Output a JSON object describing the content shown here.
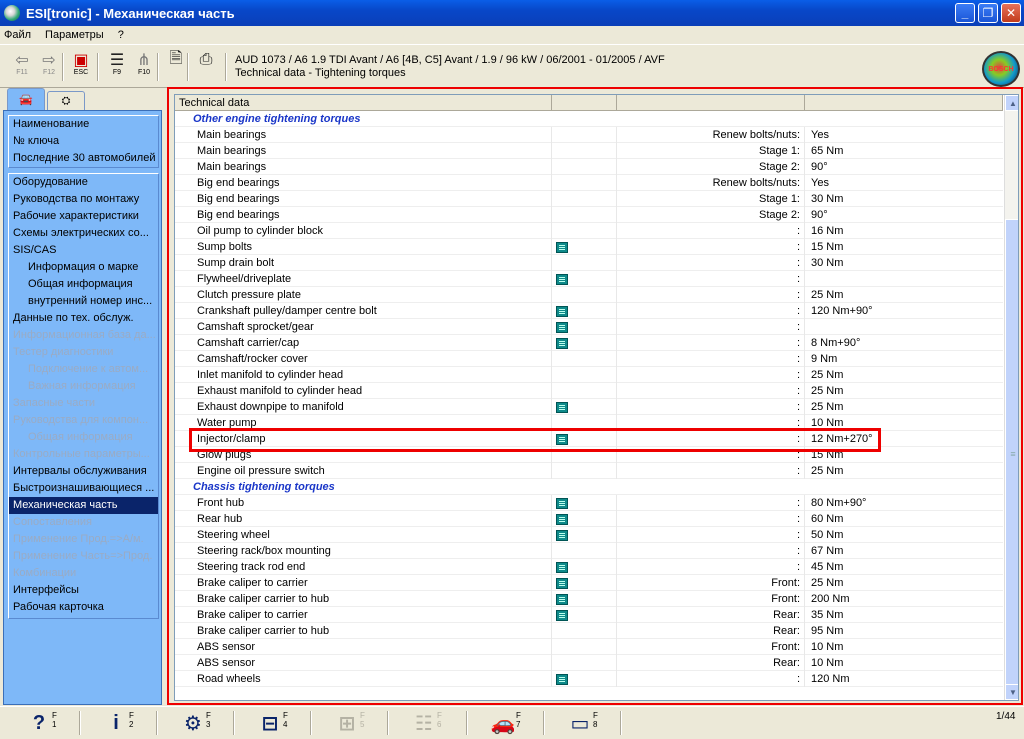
{
  "title": "ESI[tronic] - Механическая часть",
  "window_buttons": {
    "minimize": "_",
    "maximize": "❐",
    "close": "✕"
  },
  "menu": [
    "Файл",
    "Параметры",
    "?"
  ],
  "toolbar": {
    "buttons": [
      {
        "key": "F11",
        "icon": "back-arrow-icon",
        "glyph": "⇦"
      },
      {
        "key": "F12",
        "icon": "forward-arrow-icon",
        "glyph": "⇨"
      },
      {
        "key": "ESC",
        "icon": "exit-icon",
        "glyph": "▣"
      },
      {
        "key": "F9",
        "icon": "list-icon",
        "glyph": "☰"
      },
      {
        "key": "F10",
        "icon": "tree-icon",
        "glyph": "⋔"
      },
      {
        "key": "",
        "icon": "document-icon",
        "glyph": "🗎"
      },
      {
        "key": "",
        "icon": "printer-icon",
        "glyph": "⎙"
      }
    ],
    "vehicle": "AUD 1073 / A6 1.9 TDI Avant / A6 [4B, C5] Avant / 1.9 / 96 kW / 06/2001 - 01/2005 / AVF",
    "path": "Technical data - Tightening torques",
    "logo": "BOSCH"
  },
  "sidebar": {
    "tabs": [
      {
        "icon": "car-icon",
        "glyph": "🚘"
      },
      {
        "icon": "engine-icon",
        "glyph": "⛭"
      }
    ],
    "group1": [
      "Наименование",
      "№ ключа",
      "Последние 30 автомобилей"
    ],
    "group2": [
      {
        "label": "Оборудование",
        "indent": false,
        "state": "on"
      },
      {
        "label": "Руководства по монтажу",
        "indent": false,
        "state": "on"
      },
      {
        "label": "Рабочие характеристики",
        "indent": false,
        "state": "on"
      },
      {
        "label": "Схемы электрических со...",
        "indent": false,
        "state": "on"
      },
      {
        "label": "SIS/CAS",
        "indent": false,
        "state": "on"
      },
      {
        "label": "Информация о марке",
        "indent": true,
        "state": "on"
      },
      {
        "label": "Общая информация",
        "indent": true,
        "state": "on"
      },
      {
        "label": "внутренний номер инс...",
        "indent": true,
        "state": "on"
      },
      {
        "label": "Данные по тех. обслуж.",
        "indent": false,
        "state": "on"
      },
      {
        "label": "Информационная база да...",
        "indent": false,
        "state": "dis"
      },
      {
        "label": "Тестер диагностики",
        "indent": false,
        "state": "dis"
      },
      {
        "label": "Подключение к автом...",
        "indent": true,
        "state": "dis"
      },
      {
        "label": "Важная информация",
        "indent": true,
        "state": "dis"
      },
      {
        "label": "Запасные части",
        "indent": false,
        "state": "dis"
      },
      {
        "label": "Руководства для компон...",
        "indent": false,
        "state": "dis"
      },
      {
        "label": "Общая информация",
        "indent": true,
        "state": "dis"
      },
      {
        "label": "Контрольные параметры...",
        "indent": false,
        "state": "dis"
      },
      {
        "label": "Интервалы обслуживания",
        "indent": false,
        "state": "on"
      },
      {
        "label": "Быстроизнашивающиеся ...",
        "indent": false,
        "state": "on"
      },
      {
        "label": "Механическая часть",
        "indent": false,
        "state": "sel"
      },
      {
        "label": "Сопоставления",
        "indent": false,
        "state": "dis"
      },
      {
        "label": "Применение Прод.=>А/м.",
        "indent": false,
        "state": "dis"
      },
      {
        "label": "Применение Часть=>Прод.",
        "indent": false,
        "state": "dis"
      },
      {
        "label": "Комбинации",
        "indent": false,
        "state": "dis"
      },
      {
        "label": "Интерфейсы",
        "indent": false,
        "state": "on"
      },
      {
        "label": "Рабочая карточка",
        "indent": false,
        "state": "on"
      }
    ]
  },
  "table": {
    "headers": [
      "Technical data",
      "",
      "",
      ""
    ],
    "rows": [
      {
        "section": "Other engine tightening torques"
      },
      {
        "name": "Main bearings",
        "doc": false,
        "cond": "Renew bolts/nuts:",
        "val": "Yes"
      },
      {
        "name": "Main bearings",
        "doc": false,
        "cond": "Stage 1:",
        "val": "65 Nm"
      },
      {
        "name": "Main bearings",
        "doc": false,
        "cond": "Stage 2:",
        "val": "90°"
      },
      {
        "name": "Big end bearings",
        "doc": false,
        "cond": "Renew bolts/nuts:",
        "val": "Yes"
      },
      {
        "name": "Big end bearings",
        "doc": false,
        "cond": "Stage 1:",
        "val": "30 Nm"
      },
      {
        "name": "Big end bearings",
        "doc": false,
        "cond": "Stage 2:",
        "val": "90°"
      },
      {
        "name": "Oil pump to cylinder block",
        "doc": false,
        "cond": ":",
        "val": "16 Nm"
      },
      {
        "name": "Sump bolts",
        "doc": true,
        "cond": ":",
        "val": "15 Nm"
      },
      {
        "name": "Sump drain bolt",
        "doc": false,
        "cond": ":",
        "val": "30 Nm"
      },
      {
        "name": "Flywheel/driveplate",
        "doc": true,
        "cond": ":",
        "val": ""
      },
      {
        "name": "Clutch pressure plate",
        "doc": false,
        "cond": ":",
        "val": "25 Nm"
      },
      {
        "name": "Crankshaft pulley/damper centre bolt",
        "doc": true,
        "cond": ":",
        "val": "120 Nm+90°"
      },
      {
        "name": "Camshaft sprocket/gear",
        "doc": true,
        "cond": ":",
        "val": ""
      },
      {
        "name": "Camshaft carrier/cap",
        "doc": true,
        "cond": ":",
        "val": "8 Nm+90°"
      },
      {
        "name": "Camshaft/rocker cover",
        "doc": false,
        "cond": ":",
        "val": "9 Nm"
      },
      {
        "name": "Inlet manifold to cylinder head",
        "doc": false,
        "cond": ":",
        "val": "25 Nm"
      },
      {
        "name": "Exhaust manifold to cylinder head",
        "doc": false,
        "cond": ":",
        "val": "25 Nm"
      },
      {
        "name": "Exhaust downpipe to manifold",
        "doc": true,
        "cond": ":",
        "val": "25 Nm"
      },
      {
        "name": "Water pump",
        "doc": false,
        "cond": ":",
        "val": "10 Nm"
      },
      {
        "name": "Injector/clamp",
        "doc": true,
        "cond": ":",
        "val": "12 Nm+270°"
      },
      {
        "name": "Glow plugs",
        "doc": false,
        "cond": ":",
        "val": "15 Nm"
      },
      {
        "name": "Engine oil pressure switch",
        "doc": false,
        "cond": ":",
        "val": "25 Nm"
      },
      {
        "section": "Chassis tightening torques"
      },
      {
        "name": "Front hub",
        "doc": true,
        "cond": ":",
        "val": "80 Nm+90°"
      },
      {
        "name": "Rear hub",
        "doc": true,
        "cond": ":",
        "val": "60 Nm"
      },
      {
        "name": "Steering wheel",
        "doc": true,
        "cond": ":",
        "val": "50 Nm"
      },
      {
        "name": "Steering rack/box mounting",
        "doc": false,
        "cond": ":",
        "val": "67 Nm"
      },
      {
        "name": "Steering track rod end",
        "doc": true,
        "cond": ":",
        "val": "45 Nm"
      },
      {
        "name": "Brake caliper to carrier",
        "doc": true,
        "cond": "Front:",
        "val": "25 Nm"
      },
      {
        "name": "Brake caliper carrier to hub",
        "doc": true,
        "cond": "Front:",
        "val": "200 Nm"
      },
      {
        "name": "Brake caliper to carrier",
        "doc": true,
        "cond": "Rear:",
        "val": "35 Nm"
      },
      {
        "name": "Brake caliper carrier to hub",
        "doc": false,
        "cond": "Rear:",
        "val": "95 Nm"
      },
      {
        "name": "ABS sensor",
        "doc": false,
        "cond": "Front:",
        "val": "10 Nm"
      },
      {
        "name": "ABS sensor",
        "doc": false,
        "cond": "Rear:",
        "val": "10 Nm"
      },
      {
        "name": "Road wheels",
        "doc": true,
        "cond": ":",
        "val": "120 Nm"
      }
    ]
  },
  "scrollbar": {
    "up": "▲",
    "down": "▼",
    "grip": "≡"
  },
  "bottombar": {
    "buttons": [
      {
        "icon": "help-icon",
        "glyph": "?",
        "fkey": "F\n1",
        "enabled": true
      },
      {
        "icon": "info-icon",
        "glyph": "i",
        "fkey": "F\n2",
        "enabled": true
      },
      {
        "icon": "car-search-icon",
        "glyph": "⚙",
        "fkey": "F\n3",
        "enabled": true
      },
      {
        "icon": "vehicle-lift-icon",
        "glyph": "⊟",
        "fkey": "F\n4",
        "enabled": true
      },
      {
        "icon": "component-icon",
        "glyph": "⊞",
        "fkey": "F\n5",
        "enabled": false
      },
      {
        "icon": "parts-list-icon",
        "glyph": "☷",
        "fkey": "F\n6",
        "enabled": false
      },
      {
        "icon": "car-icon",
        "glyph": "🚗",
        "fkey": "F\n7",
        "enabled": true
      },
      {
        "icon": "monitor-icon",
        "glyph": "▭",
        "fkey": "F\n8",
        "enabled": true
      }
    ],
    "page": "1/44"
  }
}
